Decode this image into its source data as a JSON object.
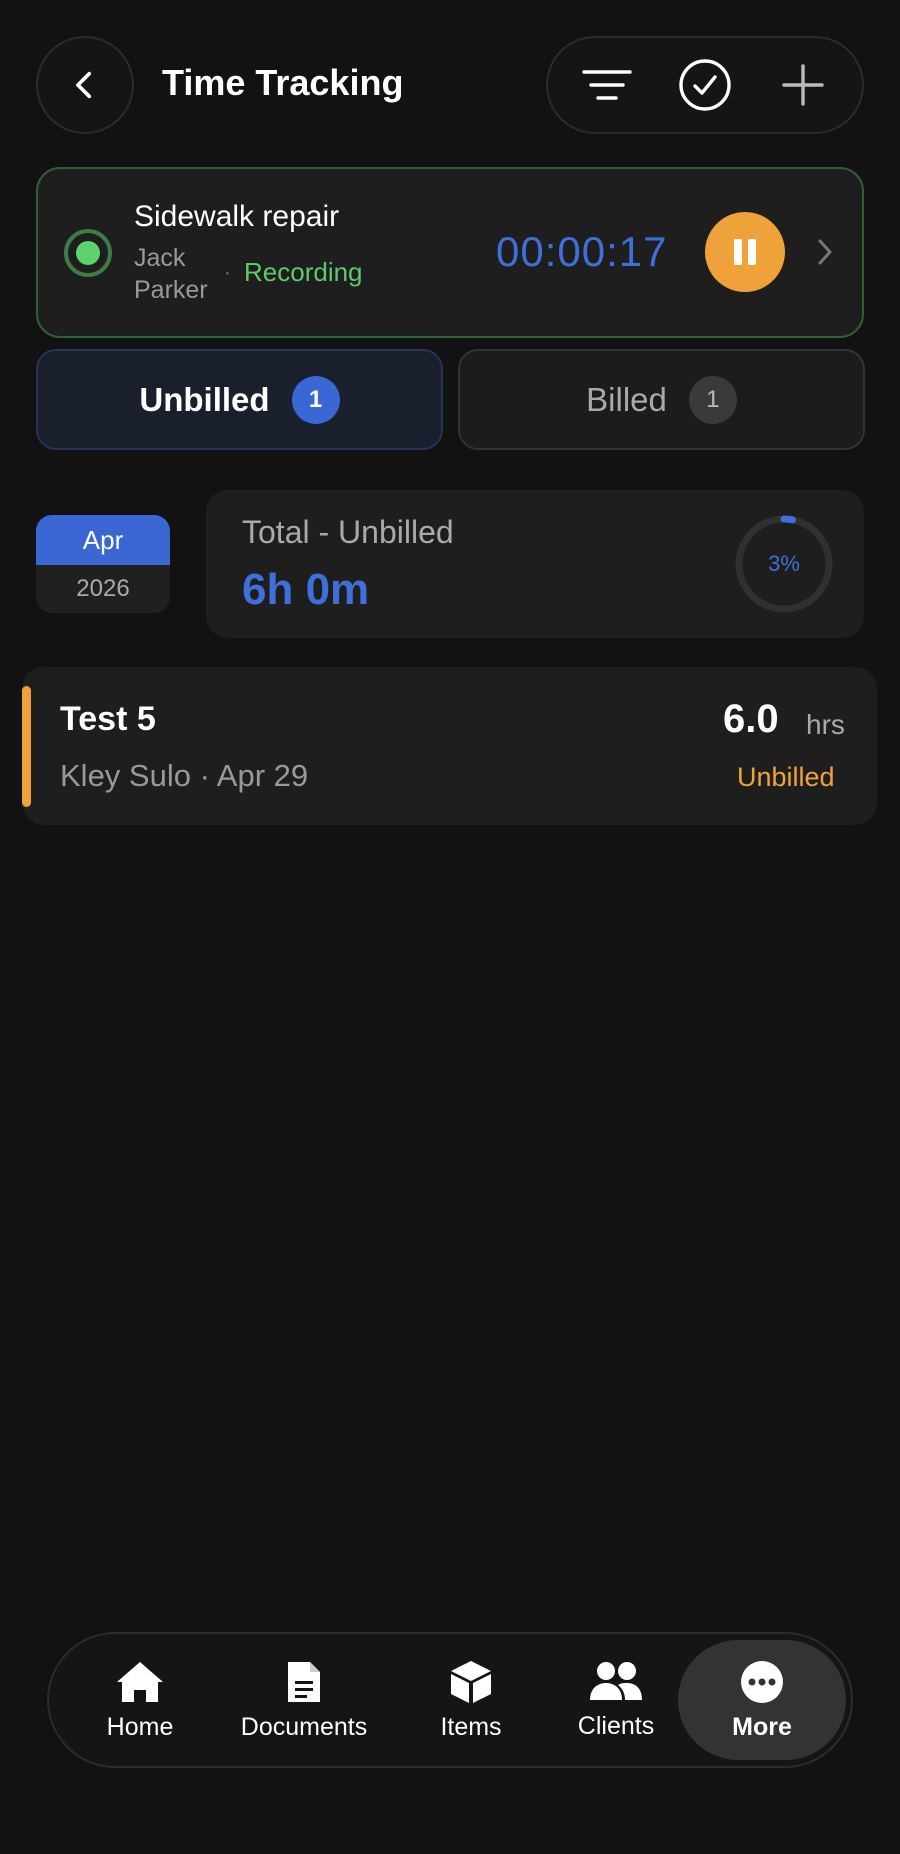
{
  "header": {
    "title": "Time Tracking",
    "icons": [
      "back-chevron-icon",
      "filter-icon",
      "check-circle-icon",
      "plus-icon"
    ]
  },
  "recording": {
    "title": "Sidewalk repair",
    "person": "Jack Parker",
    "separator": "·",
    "status": "Recording",
    "timer": "00:00:17",
    "colors": {
      "status": "#5fc96a",
      "timer": "#3f6fd8",
      "pause": "#f0a23a"
    }
  },
  "tabs": [
    {
      "label": "Unbilled",
      "count": "1",
      "active": true
    },
    {
      "label": "Billed",
      "count": "1",
      "active": false
    }
  ],
  "summary": {
    "month": "Apr",
    "year": "2026",
    "label": "Total - Unbilled",
    "value": "6h 0m",
    "progress_percent": 3,
    "progress_label": "3%"
  },
  "entries": [
    {
      "title": "Test 5",
      "subtitle": "Kley Sulo · Apr 29",
      "hours": "6.0",
      "unit": "hrs",
      "status": "Unbilled",
      "accent": "#f0a23a"
    }
  ],
  "nav": [
    {
      "label": "Home",
      "icon": "home-icon"
    },
    {
      "label": "Documents",
      "icon": "document-icon"
    },
    {
      "label": "Items",
      "icon": "box-icon"
    },
    {
      "label": "Clients",
      "icon": "users-icon"
    },
    {
      "label": "More",
      "icon": "more-icon",
      "active": true
    }
  ]
}
